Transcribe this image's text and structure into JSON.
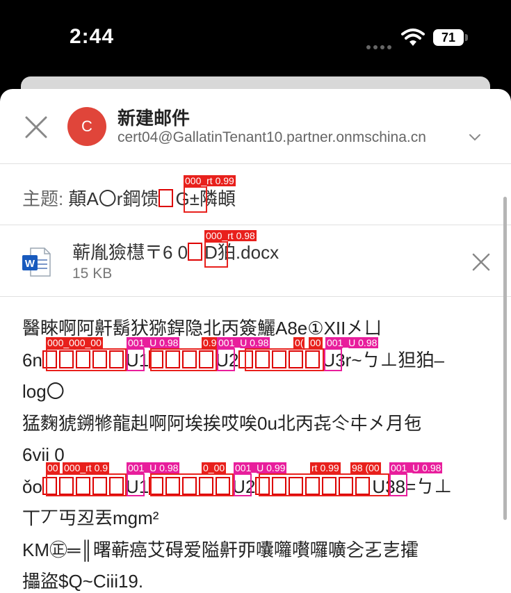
{
  "status_bar": {
    "time": "2:44",
    "battery": "71"
  },
  "compose": {
    "title": "新建邮件",
    "avatar_letter": "C",
    "from": "cert04@GallatinTenant10.partner.onmschina.cn",
    "subject_label": "主题:",
    "subject_value_a": "顛A〇r鋼馈",
    "subject_value_b": "G±隣頔"
  },
  "attachment": {
    "name_a": "蕲胤獫櫘〒6 0",
    "name_b": "D狛.docx",
    "size": "15 KB"
  },
  "body": {
    "line1": "醫睞啊阿鼾鬍犾猕銲隐北丙簽鱺A8e①XII㐅ㄩ",
    "line2a": "6n",
    "line2b": "U1",
    "line2c": "U2",
    "line2d": "U3r~ㄅ⊥狚狛–",
    "line3": "log〇",
    "line4": "猛麴猇鎙㹋龍赳啊阿埃挨哎唉0u北丙㐂仒㐄㐅月㐌",
    "line5": "6vii 0",
    "line6a": "ǒo",
    "line6b": "U1",
    "line6c": "U2",
    "line6d": "U38=ㄅ⊥",
    "line7": "丅丆丏丒丟mgm²",
    "line8": "KM㊣═║曙蕲癌艾碍爱隘鼾丣囔囖嚽囉嚝㐈㐉㐊攉",
    "line9": "攂盜$Q~Ciii19."
  },
  "overlays": {
    "subject_tag": "000_rt 0.99",
    "attachment_tag": "000_rt 0.98",
    "line2_tags": [
      "000_000_00",
      "001_U 0.98",
      "0.9",
      "001_U 0.98",
      "0(",
      "00",
      "001_U 0.98"
    ],
    "line6_tags": [
      "00",
      "000_rt 0.9",
      "001_U 0.98",
      "0_00",
      "001_U 0.99",
      "rt 0.99",
      "98 (00",
      "001_U 0.98"
    ]
  }
}
